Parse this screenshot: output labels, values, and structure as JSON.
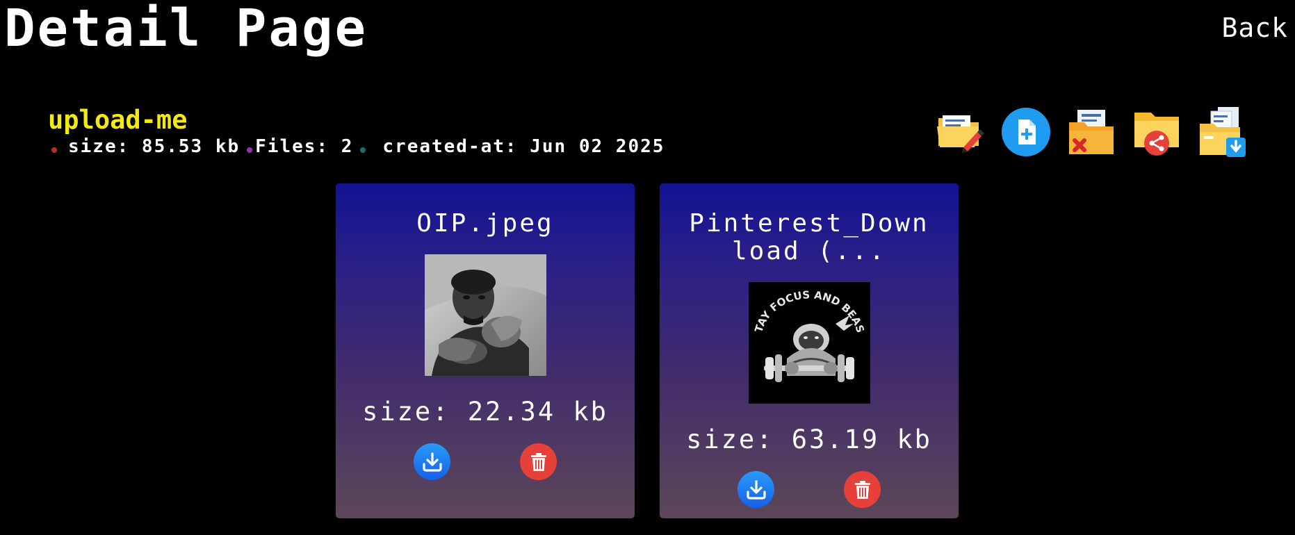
{
  "header": {
    "title": "Detail Page",
    "back_label": "Back"
  },
  "folder": {
    "name": "upload-me",
    "size_text": "size: 85.53 kb",
    "files_text": "Files: 2",
    "created_text": "created-at: Jun 02 2025",
    "dot_colors": [
      "#b3302b",
      "#9b2fae",
      "#1f6b6b"
    ]
  },
  "toolbar": {
    "icons": [
      "folder-edit-icon",
      "add-file-icon",
      "folder-delete-icon",
      "folder-share-icon",
      "folder-download-icon"
    ],
    "accent": "#1f9cf0"
  },
  "files": [
    {
      "name": "OIP.jpeg",
      "size": "size: 22.34 kb",
      "thumbnail": "grayscale-portrait-photo"
    },
    {
      "name": "Pinterest_Download (...",
      "size": "size: 63.19 kb",
      "thumbnail": "stay-focus-and-beast-logo",
      "thumbnail_text": "STAY FOCUS AND BEAST"
    }
  ],
  "colors": {
    "folder_name": "#f4ea12",
    "download": "#1f7cf0",
    "delete": "#e5403a"
  }
}
